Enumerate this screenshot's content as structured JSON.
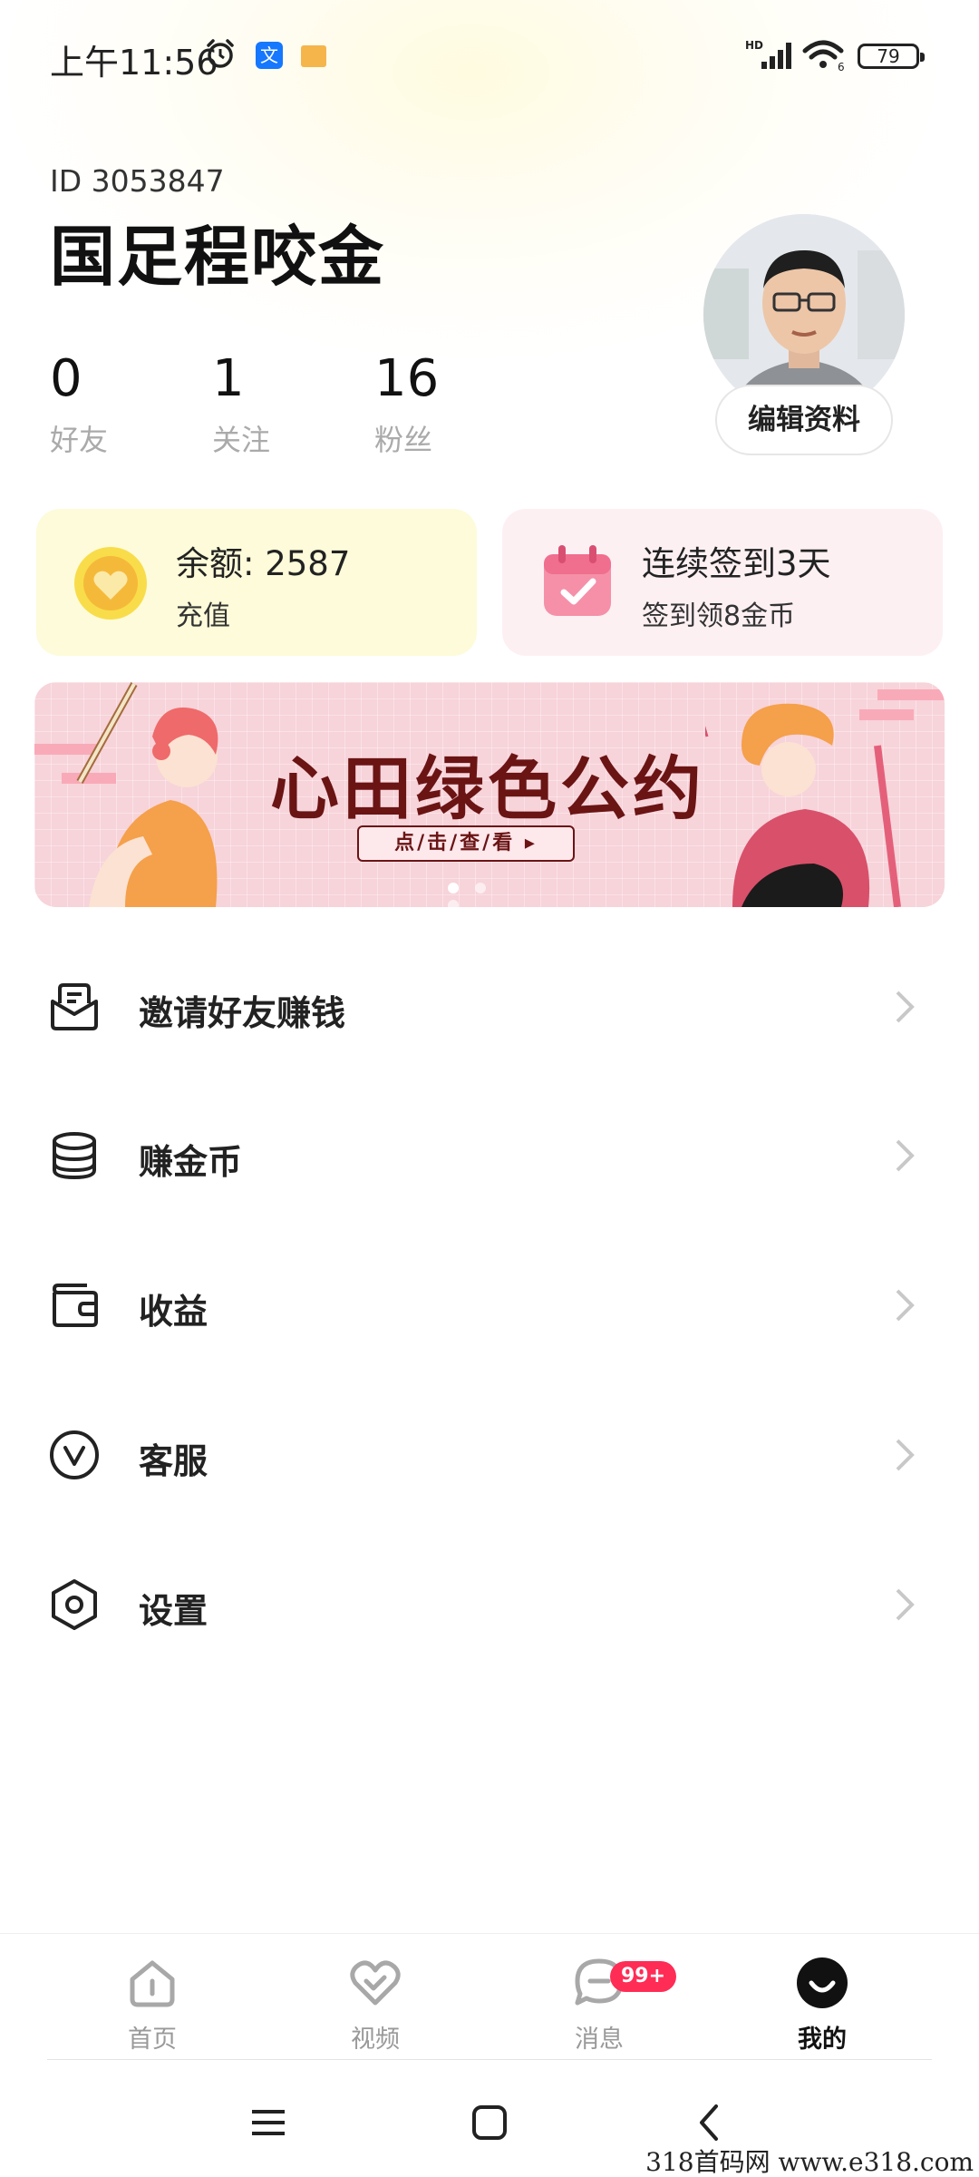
{
  "status_bar": {
    "time": "上午11:56",
    "app_icon_text": "文",
    "battery": "79"
  },
  "profile": {
    "id_text": "ID 3053847",
    "name": "国足程咬金",
    "edit_label": "编辑资料",
    "stats": [
      {
        "value": "0",
        "label": "好友"
      },
      {
        "value": "1",
        "label": "关注"
      },
      {
        "value": "16",
        "label": "粉丝"
      }
    ]
  },
  "cards": {
    "balance_title": "余额: 2587",
    "balance_sub": "充值",
    "checkin_title": "连续签到3天",
    "checkin_sub": "签到领8金币"
  },
  "banner": {
    "title": "心田绿色公约",
    "cta": "点/击/查/看 ▸",
    "pages": 3,
    "current_page": 1
  },
  "menu": [
    {
      "label": "邀请好友赚钱",
      "icon": "invite-icon"
    },
    {
      "label": "赚金币",
      "icon": "coins-icon"
    },
    {
      "label": "收益",
      "icon": "wallet-icon"
    },
    {
      "label": "客服",
      "icon": "service-icon"
    },
    {
      "label": "设置",
      "icon": "settings-icon"
    }
  ],
  "tabs": [
    {
      "label": "首页",
      "icon": "home-icon"
    },
    {
      "label": "视频",
      "icon": "heart-video-icon"
    },
    {
      "label": "消息",
      "icon": "message-icon",
      "badge": "99+"
    },
    {
      "label": "我的",
      "icon": "me-icon",
      "active": true
    }
  ],
  "watermark": "318首码网  www.e318.com",
  "colors": {
    "balance_card": "#fdfbd9",
    "checkin_card": "#fdf0f3",
    "banner_bg": "#f7d3da",
    "banner_text": "#6a1414",
    "badge": "#ff2c55"
  }
}
